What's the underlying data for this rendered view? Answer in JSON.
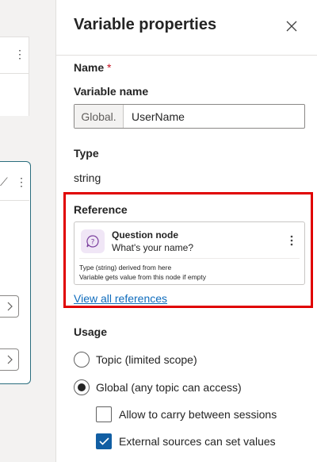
{
  "panel": {
    "title": "Variable properties",
    "name_section": {
      "label": "Name",
      "required_marker": "*",
      "variable_name_label": "Variable name",
      "prefix": "Global.",
      "value": "UserName"
    },
    "type_section": {
      "label": "Type",
      "value": "string"
    },
    "reference_section": {
      "label": "Reference",
      "card": {
        "icon": "question-node-icon",
        "title": "Question node",
        "subtitle": "What's your name?",
        "note_line1": "Type (string) derived from here",
        "note_line2": "Variable gets value from this node if empty"
      },
      "view_all_link": "View all references"
    },
    "usage_section": {
      "label": "Usage",
      "radio_topic": "Topic (limited scope)",
      "radio_global": "Global (any topic can access)",
      "selected": "global",
      "check_carry": "Allow to carry between sessions",
      "check_carry_checked": false,
      "check_external": "External sources can set values",
      "check_external_checked": true
    }
  },
  "colors": {
    "accent": "#115ea3",
    "link": "#0f6cbd",
    "highlight": "#e00000",
    "canvas_card_border": "#2b6e7e",
    "required": "#c50f1f"
  }
}
